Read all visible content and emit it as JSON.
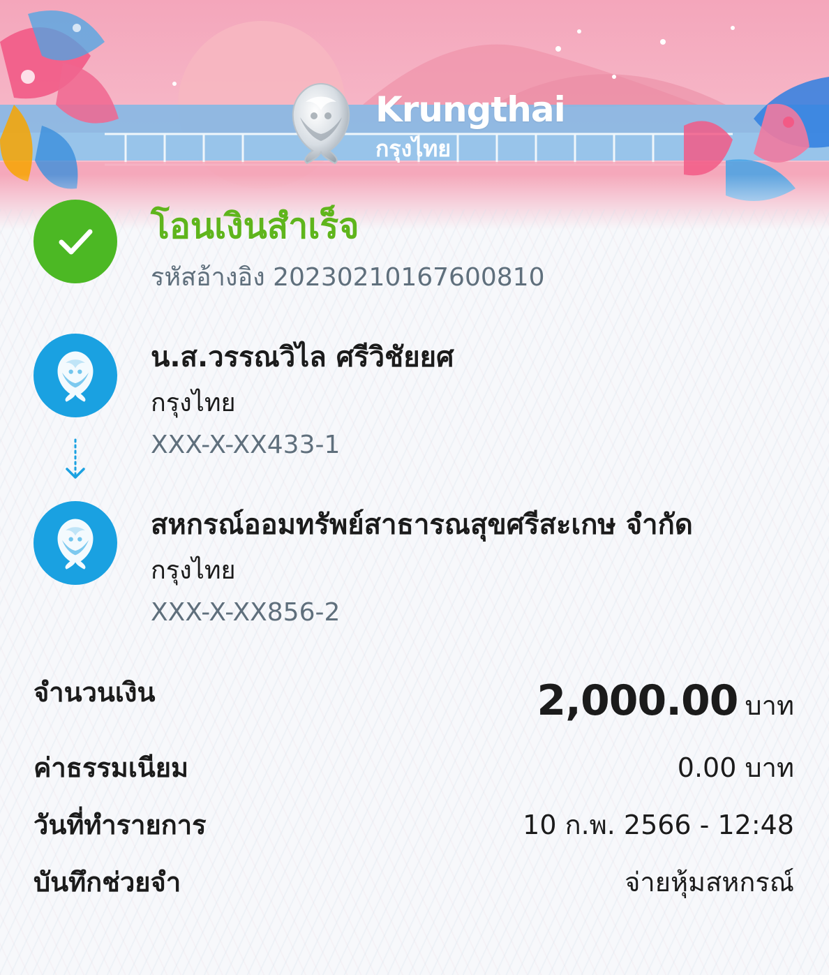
{
  "header": {
    "brand_en": "Krungthai",
    "brand_th": "กรุงไทย",
    "logo_icon": "krungthai-phoenix-logo"
  },
  "status": {
    "icon": "check-circle-icon",
    "color": "#4cb824",
    "title": "โอนเงินสำเร็จ",
    "reference_label": "รหัสอ้างอิง",
    "reference_number": "20230210167600810"
  },
  "sender": {
    "name": "น.ส.วรรณวิไล ศรีวิชัยยศ",
    "bank": "กรุงไทย",
    "account": "XXX-X-XX433-1"
  },
  "receiver": {
    "name": "สหกรณ์ออมทรัพย์สาธารณสุขศรีสะเกษ จำกัด",
    "bank": "กรุงไทย",
    "account": "XXX-X-XX856-2"
  },
  "details": {
    "amount_label": "จำนวนเงิน",
    "amount_value": "2,000.00",
    "amount_unit": "บาท",
    "fee_label": "ค่าธรรมเนียม",
    "fee_value": "0.00 บาท",
    "date_label": "วันที่ทำรายการ",
    "date_value": "10 ก.พ. 2566 - 12:48",
    "memo_label": "บันทึกช่วยจำ",
    "memo_value": "จ่ายหุ้มสหกรณ์"
  },
  "colors": {
    "success": "#5fb51c",
    "bank_blue": "#1aa1e1",
    "muted_text": "#5f6f7c"
  }
}
